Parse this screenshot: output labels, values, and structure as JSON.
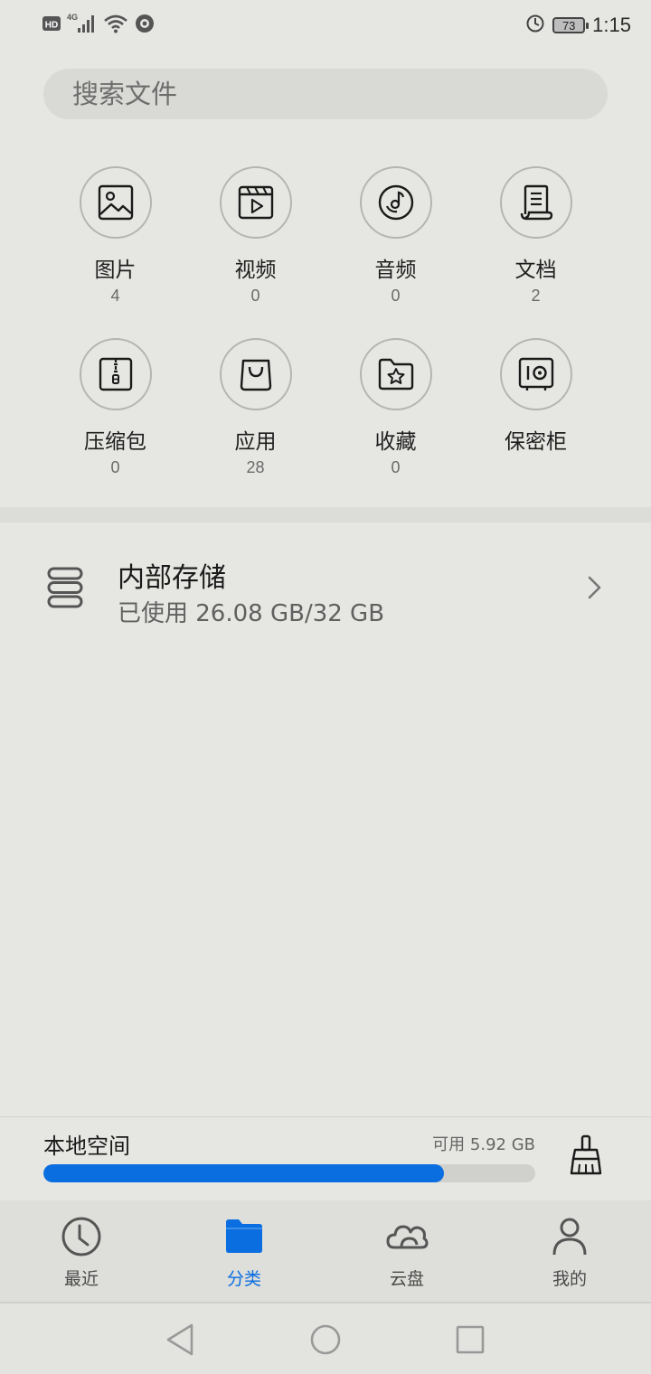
{
  "status_bar": {
    "left_icons": [
      "hd-icon",
      "4g-signal-icon",
      "wifi-icon",
      "vpn-icon"
    ],
    "hd_label": "HD",
    "network_label": "4G",
    "battery_level": "73",
    "time": "1:15"
  },
  "search": {
    "placeholder": "搜索文件"
  },
  "categories": [
    {
      "icon": "image-icon",
      "label": "图片",
      "count": "4"
    },
    {
      "icon": "video-icon",
      "label": "视频",
      "count": "0"
    },
    {
      "icon": "music-icon",
      "label": "音频",
      "count": "0"
    },
    {
      "icon": "document-icon",
      "label": "文档",
      "count": "2"
    },
    {
      "icon": "zip-icon",
      "label": "压缩包",
      "count": "0"
    },
    {
      "icon": "shopping-bag-icon",
      "label": "应用",
      "count": "28"
    },
    {
      "icon": "star-folder-icon",
      "label": "收藏",
      "count": "0"
    },
    {
      "icon": "safe-icon",
      "label": "保密柜",
      "count": ""
    }
  ],
  "storage": {
    "icon": "storage-icon",
    "title": "内部存储",
    "subtitle": "已使用 26.08 GB/32 GB",
    "used_gb": 26.08,
    "total_gb": 32
  },
  "local_space": {
    "title": "本地空间",
    "available": "可用 5.92 GB",
    "used_fraction": 0.815,
    "bar_color": "#0a6ee0"
  },
  "bottom_nav": [
    {
      "icon": "clock-icon",
      "label": "最近",
      "active": false
    },
    {
      "icon": "folder-icon",
      "label": "分类",
      "active": true
    },
    {
      "icon": "cloud-icon",
      "label": "云盘",
      "active": false
    },
    {
      "icon": "person-icon",
      "label": "我的",
      "active": false
    }
  ],
  "colors": {
    "accent": "#0a6ee0",
    "background": "#e6e6e3"
  }
}
